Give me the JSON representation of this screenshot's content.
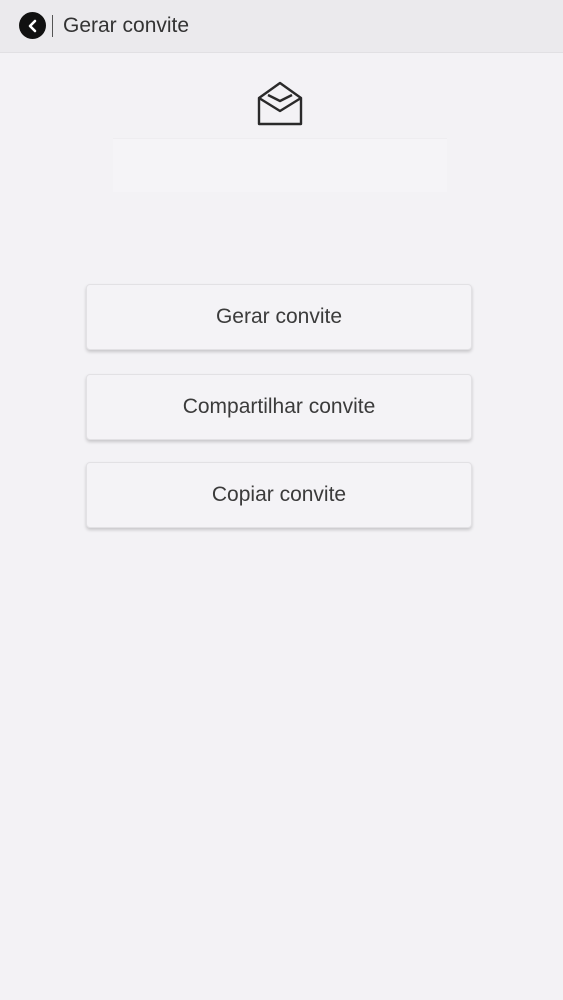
{
  "header": {
    "title": "Gerar convite",
    "back_icon": "chevron-left-icon"
  },
  "invite": {
    "icon": "open-envelope-icon",
    "code": ""
  },
  "actions": {
    "generate_label": "Gerar convite",
    "share_label": "Compartilhar convite",
    "copy_label": "Copiar convite"
  },
  "colors": {
    "background": "#f3f2f5",
    "header_background": "#ebeaed",
    "text": "#3b3b3b",
    "back_button": "#111111"
  }
}
